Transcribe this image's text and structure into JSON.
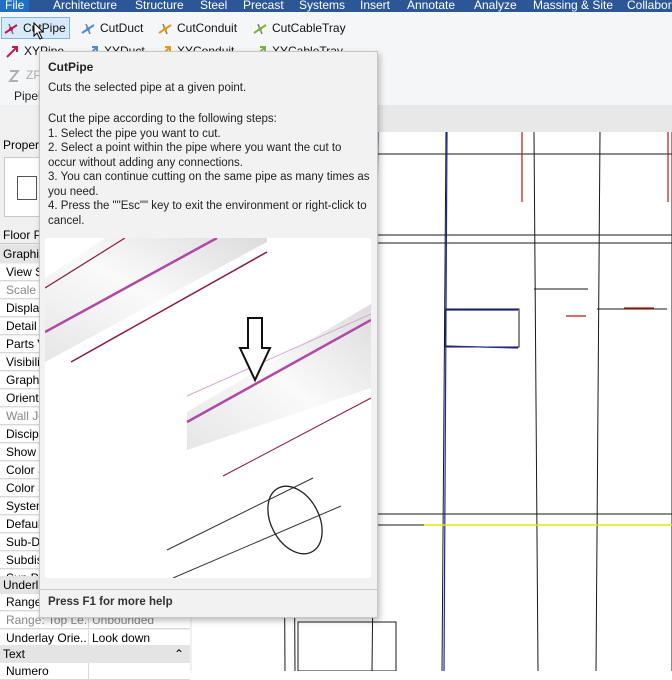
{
  "menu": {
    "items": [
      "File",
      "Architecture",
      "Structure",
      "Steel",
      "Precast",
      "Systems",
      "Insert",
      "Annotate",
      "Analyze",
      "Massing & Site",
      "Collabor"
    ]
  },
  "ribbon": {
    "buttons_row1": [
      "CutPipe",
      "CutDuct",
      "CutConduit",
      "CutCableTray"
    ],
    "buttons_row2": [
      "XYPipe",
      "XYDuct",
      "XYConduit",
      "XYCableTray"
    ],
    "row3_prefix": "ZP",
    "panel_label": "Pipel"
  },
  "properties": {
    "header": "Propert",
    "type_selector": "Floor P",
    "section_graphics": "Graphic",
    "rows": [
      {
        "label": "View S",
        "value": ""
      },
      {
        "label": "Scale V",
        "value": "",
        "gray": true
      },
      {
        "label": "Displa",
        "value": ""
      },
      {
        "label": "Detail",
        "value": ""
      },
      {
        "label": "Parts V",
        "value": ""
      },
      {
        "label": "Visibili",
        "value": ""
      },
      {
        "label": "Graphi",
        "value": ""
      },
      {
        "label": "Orient",
        "value": ""
      },
      {
        "label": "Wall Jo",
        "value": "",
        "gray": true
      },
      {
        "label": "Discipl",
        "value": ""
      },
      {
        "label": "Show I",
        "value": ""
      },
      {
        "label": "Color S",
        "value": ""
      },
      {
        "label": "Color S",
        "value": ""
      },
      {
        "label": "System",
        "value": ""
      },
      {
        "label": "Defaul",
        "value": ""
      },
      {
        "label": "Sub-D",
        "value": ""
      },
      {
        "label": "Subdis",
        "value": ""
      },
      {
        "label": "Sun Pa",
        "value": ""
      }
    ],
    "section_underlay": "Underla",
    "underlay_rows": [
      {
        "label": "Range",
        "value": ""
      },
      {
        "label": "Range: Top Le...",
        "value": "Unbounded",
        "gray": true
      },
      {
        "label": "Underlay Orie...",
        "value": "Look down"
      }
    ],
    "section_text": "Text",
    "text_rows": [
      {
        "label": "Numero",
        "value": ""
      }
    ]
  },
  "tooltip": {
    "title": "CutPipe",
    "description": "Cuts the selected pipe at a given point.",
    "intro": "Cut the pipe according to the following steps:",
    "steps": [
      "1. Select the pipe you want to cut.",
      "2. Select a point within the pipe where you want the cut to occur without adding any connections.",
      "3. You can continue cutting on the same pipe as many times as you need.",
      "4. Press the \"\"Esc\"\" key to exit the environment or right-click to cancel."
    ],
    "help": "Press F1 for more help"
  },
  "colors": {
    "menubar": "#2b5797",
    "pipe_magenta": "#b048a8",
    "pipe_edge": "#8b1a3a",
    "plan_blue": "#1a2aa0",
    "plan_red": "#cc1111",
    "plan_yellow": "#e8e800"
  }
}
